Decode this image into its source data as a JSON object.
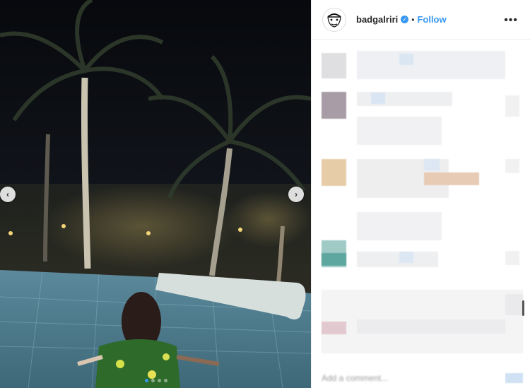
{
  "post": {
    "username": "badgalriri",
    "follow_label": "Follow",
    "separator": "•",
    "more_icon": "•••",
    "add_comment_placeholder": "Add a comment..."
  },
  "media": {
    "prev_glyph": "‹",
    "next_glyph": "›",
    "carousel_active_index": 0
  },
  "colors": {
    "accent": "#3897f0",
    "pool_tile": "#6f9fb0",
    "night_sky": "#0c0f14"
  }
}
